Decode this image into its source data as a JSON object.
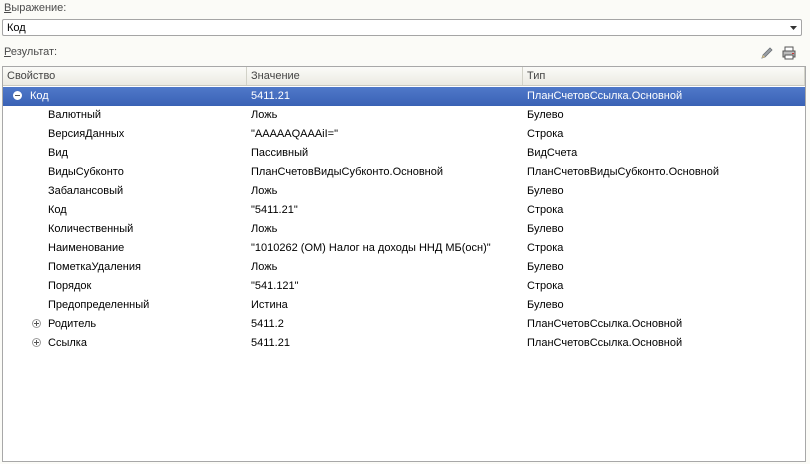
{
  "expression": {
    "label_first": "В",
    "label_rest": "ыражение:",
    "value": "Код"
  },
  "result": {
    "label_first": "Р",
    "label_rest": "езультат:"
  },
  "toolbar": {
    "edit_icon": "pencil-icon",
    "print_icon": "printer-icon"
  },
  "columns": [
    "Свойство",
    "Значение",
    "Тип"
  ],
  "rows": [
    {
      "name": "Код",
      "value": "5411.21",
      "type": "ПланСчетовСсылка.Основной",
      "expander": "minus",
      "selected": true
    },
    {
      "name": "Валютный",
      "value": "Ложь",
      "type": "Булево"
    },
    {
      "name": "ВерсияДанных",
      "value": "\"AAAAAQAAAiI=\"",
      "type": "Строка"
    },
    {
      "name": "Вид",
      "value": "Пассивный",
      "type": "ВидСчета"
    },
    {
      "name": "ВидыСубконто",
      "value": "ПланСчетовВидыСубконто.Основной",
      "type": "ПланСчетовВидыСубконто.Основной"
    },
    {
      "name": "Забалансовый",
      "value": "Ложь",
      "type": "Булево"
    },
    {
      "name": "Код",
      "value": "\"5411.21\"",
      "type": "Строка"
    },
    {
      "name": "Количественный",
      "value": "Ложь",
      "type": "Булево"
    },
    {
      "name": "Наименование",
      "value": "\"1010262 (ОМ) Налог на доходы ННД МБ(осн)\"",
      "type": "Строка"
    },
    {
      "name": "ПометкаУдаления",
      "value": "Ложь",
      "type": "Булево"
    },
    {
      "name": "Порядок",
      "value": "\"541.121\"",
      "type": "Строка"
    },
    {
      "name": "Предопределенный",
      "value": "Истина",
      "type": "Булево"
    },
    {
      "name": "Родитель",
      "value": "5411.2",
      "type": "ПланСчетовСсылка.Основной",
      "expander": "plus"
    },
    {
      "name": "Ссылка",
      "value": "5411.21",
      "type": "ПланСчетовСсылка.Основной",
      "expander": "plus"
    }
  ],
  "colors": {
    "selection": "#3a62b5",
    "background": "#fbfbf7"
  }
}
